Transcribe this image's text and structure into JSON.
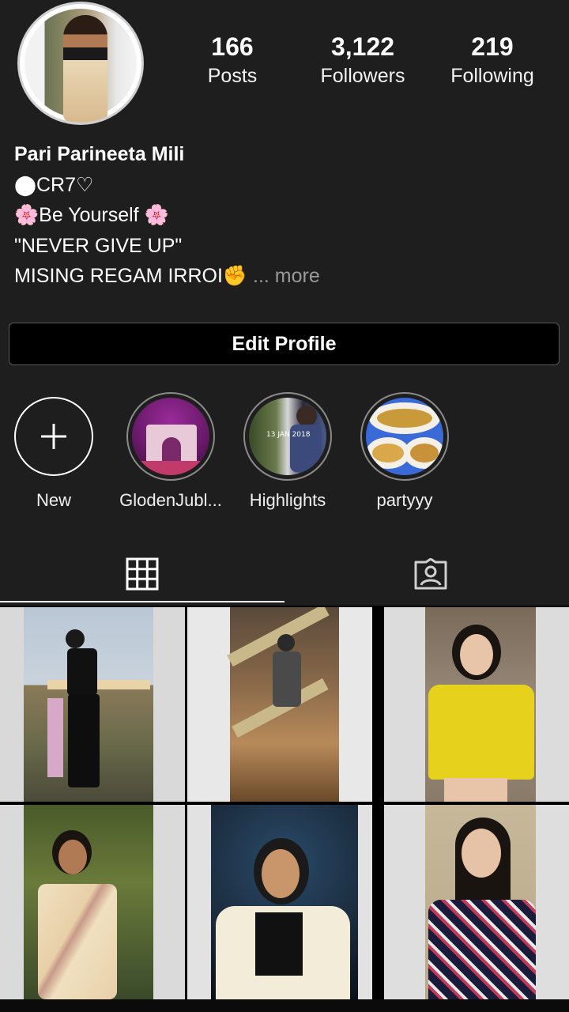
{
  "profile": {
    "name": "Pari Parineeta Mili",
    "bio_lines": [
      "⬤CR7♡",
      "Be Yourself",
      "\"NEVER GIVE UP\"",
      "MISING REGAM IRROI"
    ],
    "more_label": "... more",
    "flower_emoji": "🌸",
    "fist_emoji": "✊"
  },
  "stats": {
    "posts": {
      "value": "166",
      "label": "Posts"
    },
    "followers": {
      "value": "3,122",
      "label": "Followers"
    },
    "following": {
      "value": "219",
      "label": "Following"
    }
  },
  "edit_profile_label": "Edit Profile",
  "highlights": [
    {
      "label": "New"
    },
    {
      "label": "GlodenJubl..."
    },
    {
      "label": "Highlights",
      "image_text": "13 JAN 2018"
    },
    {
      "label": "partyyy"
    }
  ],
  "tabs": [
    {
      "icon": "grid-icon",
      "active": true
    },
    {
      "icon": "tagged-person-icon",
      "active": false
    }
  ],
  "colors": {
    "background": "#1e1e1e",
    "button_background": "#000000",
    "more_text": "#9a9a9a"
  }
}
